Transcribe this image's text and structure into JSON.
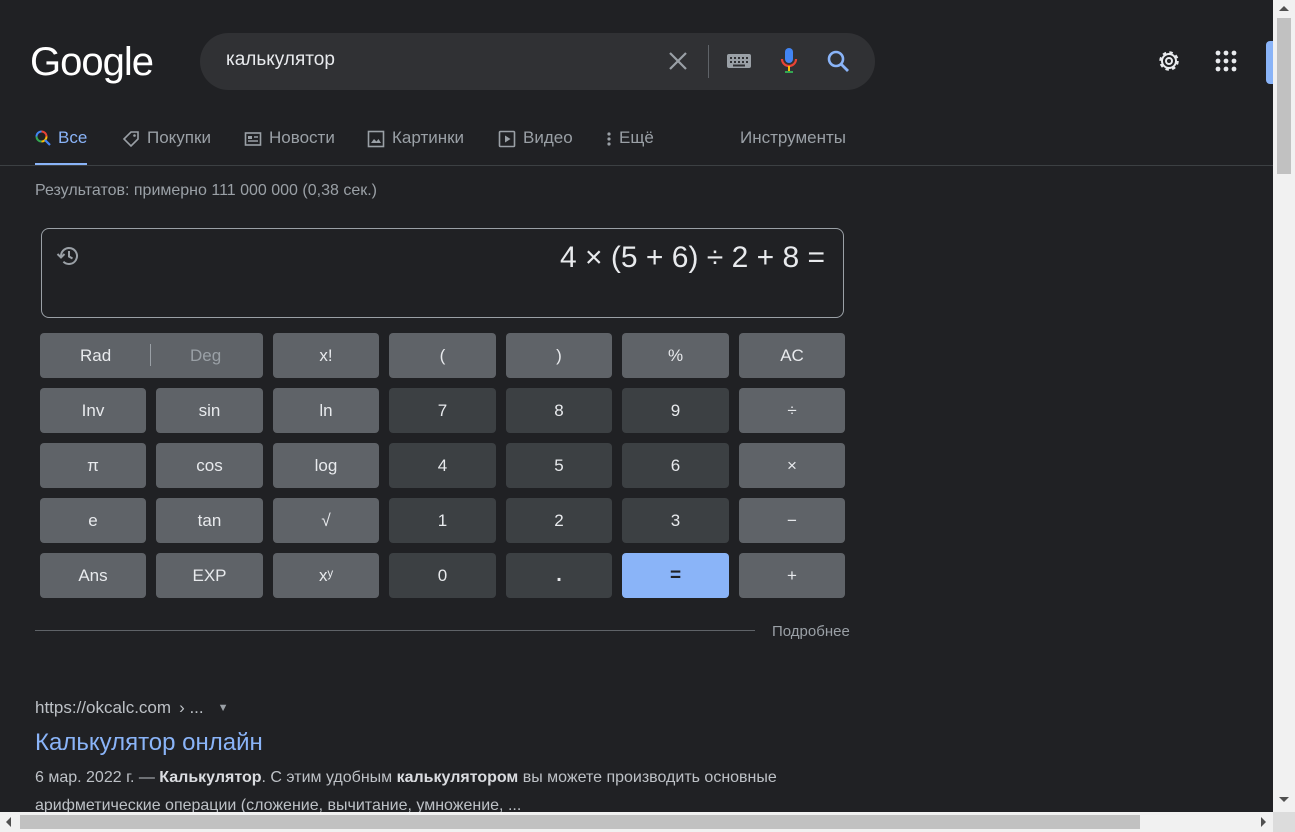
{
  "logo": "Google",
  "search": {
    "query": "калькулятор"
  },
  "tabs": [
    {
      "label": "Все"
    },
    {
      "label": "Покупки"
    },
    {
      "label": "Новости"
    },
    {
      "label": "Картинки"
    },
    {
      "label": "Видео"
    },
    {
      "label": "Ещё"
    },
    {
      "label": "Инструменты"
    }
  ],
  "stats": "Результатов: примерно 111 000 000 (0,38 сек.)",
  "calculator": {
    "expression": "4 × (5 + 6) ÷ 2 + 8 =",
    "mode": {
      "rad": "Rad",
      "deg": "Deg"
    },
    "keys": {
      "fact": "x!",
      "lparen": "(",
      "rparen": ")",
      "percent": "%",
      "ac": "AC",
      "inv": "Inv",
      "sin": "sin",
      "ln": "ln",
      "n7": "7",
      "n8": "8",
      "n9": "9",
      "div": "÷",
      "pi": "π",
      "cos": "cos",
      "log": "log",
      "n4": "4",
      "n5": "5",
      "n6": "6",
      "mul": "×",
      "e": "e",
      "tan": "tan",
      "sqrt": "√",
      "n1": "1",
      "n2": "2",
      "n3": "3",
      "minus": "−",
      "ans": "Ans",
      "exp": "EXP",
      "pow": "xʸ",
      "n0": "0",
      "dot": ".",
      "eq": "=",
      "plus": "+"
    },
    "more": "Подробнее"
  },
  "result": {
    "url": "https://okcalc.com",
    "breadcrumb": "› ...",
    "title": "Калькулятор онлайн",
    "date": "6 мар. 2022 г. —",
    "snippet_b1": "Калькулятор",
    "snippet_t1": ". С этим удобным ",
    "snippet_b2": "калькулятором",
    "snippet_t2": " вы можете производить основные арифметические операции (сложение, вычитание, умножение, ..."
  },
  "colors": {
    "background": "#202124",
    "accent": "#8ab4f8",
    "fn_key": "#5f6368",
    "num_key": "#3c4043"
  }
}
